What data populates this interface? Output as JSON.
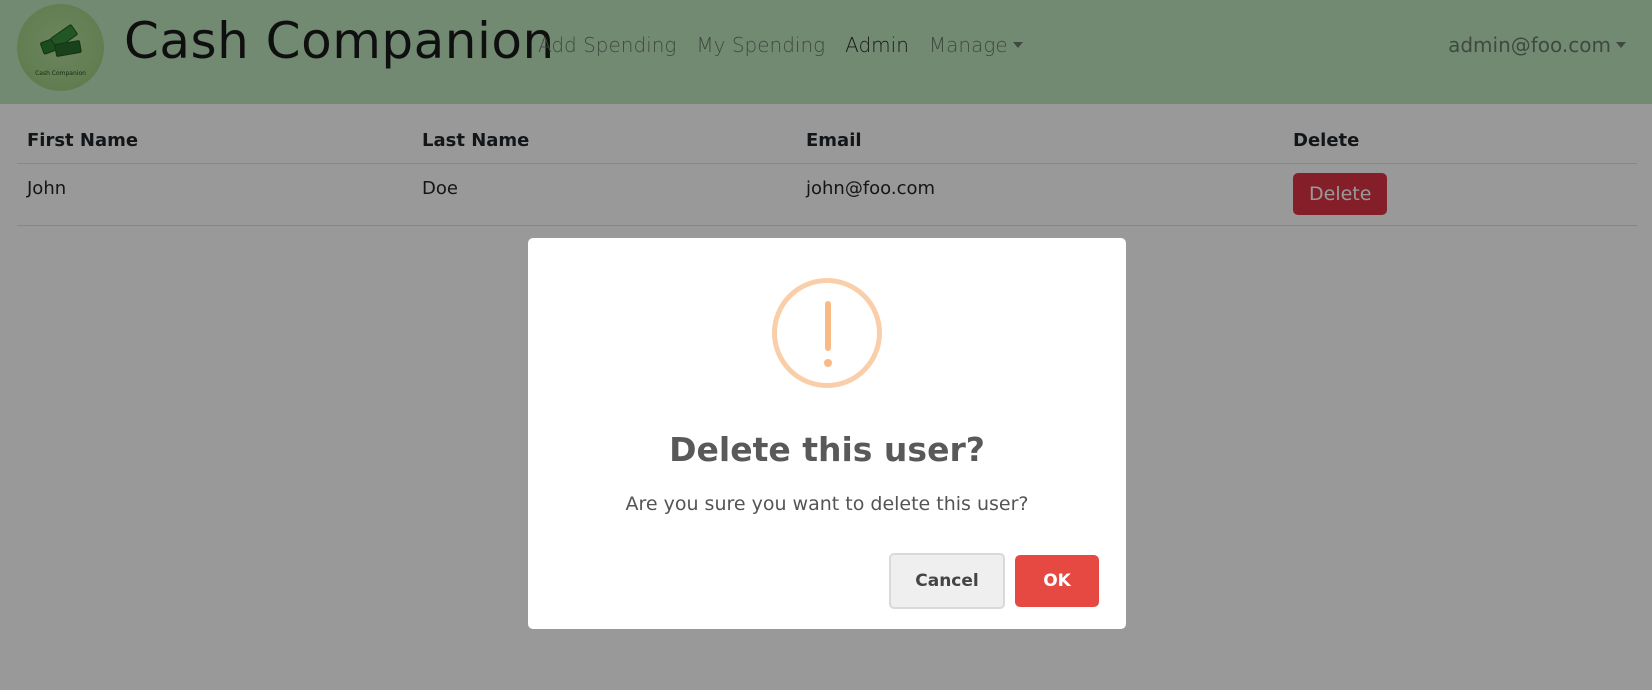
{
  "navbar": {
    "logo_caption": "Cash Companion",
    "brand": "Cash Companion",
    "links": [
      {
        "label": "Add Spending"
      },
      {
        "label": "My Spending"
      },
      {
        "label": "Admin"
      },
      {
        "label": "Manage"
      }
    ],
    "user": "admin@foo.com",
    "background_color": "#bfe6bf"
  },
  "table": {
    "headers": [
      "First Name",
      "Last Name",
      "Email",
      "Delete"
    ],
    "rows": [
      {
        "first_name": "John",
        "last_name": "Doe",
        "email": "john@foo.com",
        "delete_label": "Delete"
      }
    ]
  },
  "modal": {
    "icon": "warning-icon",
    "title": "Delete this user?",
    "text": "Are you sure you want to delete this user?",
    "cancel_label": "Cancel",
    "ok_label": "OK",
    "ok_color": "#e64942",
    "icon_color": "#f8bb86"
  }
}
